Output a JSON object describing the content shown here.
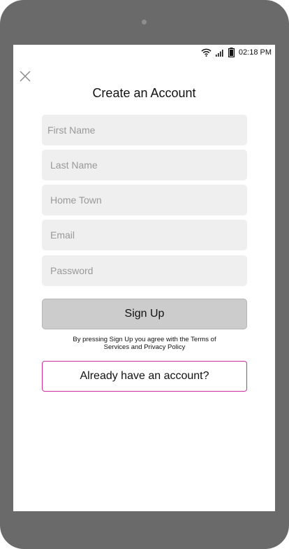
{
  "status_bar": {
    "time": "02:18 PM",
    "icons": [
      "wifi-icon",
      "signal-icon",
      "battery-icon"
    ]
  },
  "header": {
    "close_icon": "close-icon",
    "title": "Create an Account"
  },
  "form": {
    "first_name_placeholder": "First Name",
    "last_name_placeholder": "Last Name",
    "home_town_placeholder": "Home Town",
    "email_placeholder": "Email",
    "password_placeholder": "Password",
    "signup_label": "Sign Up",
    "terms_text": "By pressing Sign Up you agree with the Terms of Services and Privacy Policy",
    "account_label": "Already have an account?"
  },
  "colors": {
    "device_frame": "#6a6a6a",
    "field_bg": "#efefef",
    "signup_bg": "#cccccc",
    "account_border": "#cc2c9c"
  }
}
